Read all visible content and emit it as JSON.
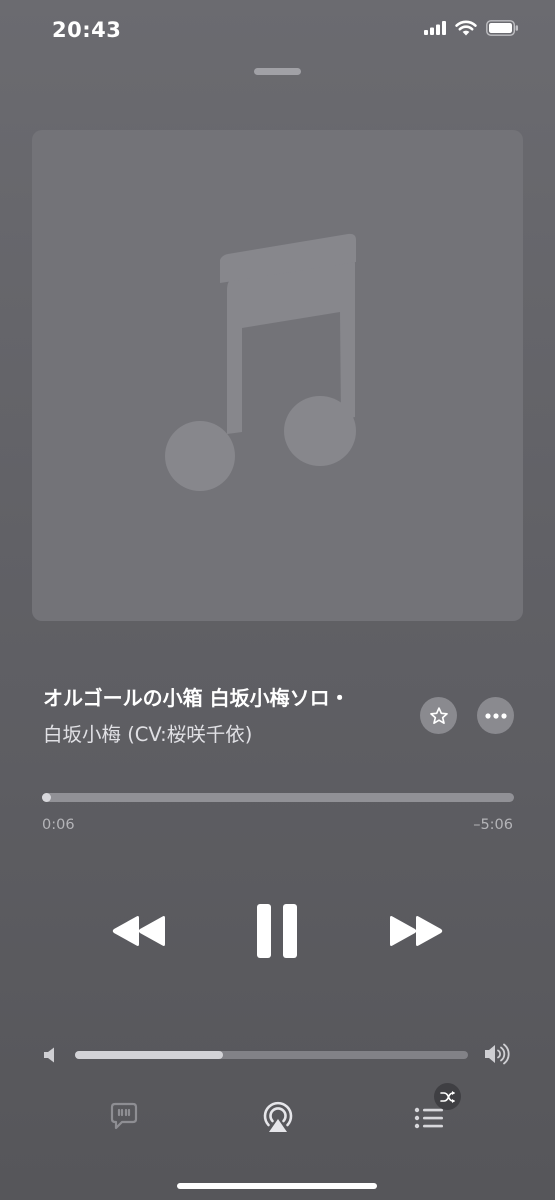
{
  "status_bar": {
    "time": "20:43"
  },
  "track": {
    "title": "オルゴールの小箱 白坂小梅ソロ・",
    "artist": "白坂小梅 (CV:桜咲千依)"
  },
  "progress": {
    "elapsed": "0:06",
    "remaining": "–5:06",
    "fraction": 0.019
  },
  "volume": {
    "level": 0.376
  },
  "icons": {
    "artwork": "music-note-icon",
    "favorite": "star-icon",
    "more": "ellipsis-icon",
    "rewind": "rewind-icon",
    "pause": "pause-icon",
    "forward": "fast-forward-icon",
    "volume_low": "speaker-low-icon",
    "volume_high": "speaker-high-icon",
    "lyrics": "lyrics-icon",
    "airplay": "airplay-icon",
    "queue": "queue-list-icon",
    "shuffle": "shuffle-icon"
  },
  "colors": {
    "background": "#616166",
    "artwork_bg": "#737378",
    "progress_fill": "#d8d8dc",
    "progress_track": "#919196"
  }
}
